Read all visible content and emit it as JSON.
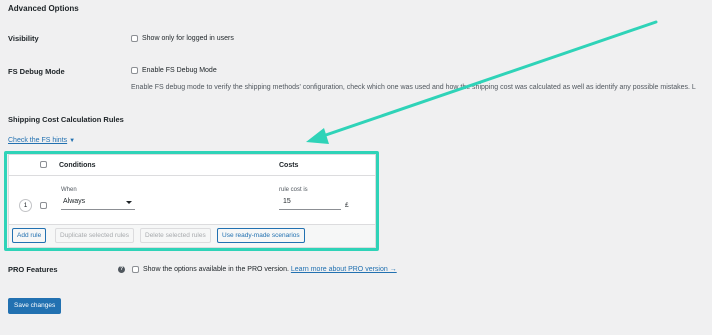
{
  "advanced": {
    "title": "Advanced Options"
  },
  "visibility": {
    "label": "Visibility",
    "checkbox_label": "Show only for logged in users"
  },
  "debug": {
    "label": "FS Debug Mode",
    "checkbox_label": "Enable FS Debug Mode",
    "description": "Enable FS debug mode to verify the shipping methods' configuration, check which one was used and how the shipping cost was calculated as well as identify any possible mistakes. L"
  },
  "rules": {
    "label": "Shipping Cost Calculation Rules",
    "hints_link": "Check the FS hints",
    "hints_arrow": "▼",
    "col_conditions": "Conditions",
    "col_costs": "Costs",
    "rows": [
      {
        "number": "1",
        "when_label": "When",
        "when_value": "Always",
        "cost_label": "rule cost is",
        "cost_value": "15",
        "currency": "£"
      }
    ],
    "buttons": {
      "add": "Add rule",
      "duplicate": "Duplicate selected rules",
      "delete": "Delete selected rules",
      "scenarios": "Use ready-made scenarios"
    }
  },
  "pro": {
    "label": "PRO Features",
    "checkbox_label": "Show the options available in the PRO version.",
    "link": "Learn more about PRO version →"
  },
  "save": {
    "label": "Save changes"
  },
  "colors": {
    "highlight": "#2fd3b8",
    "accent": "#2271b1",
    "background": "#f0f0f1"
  }
}
